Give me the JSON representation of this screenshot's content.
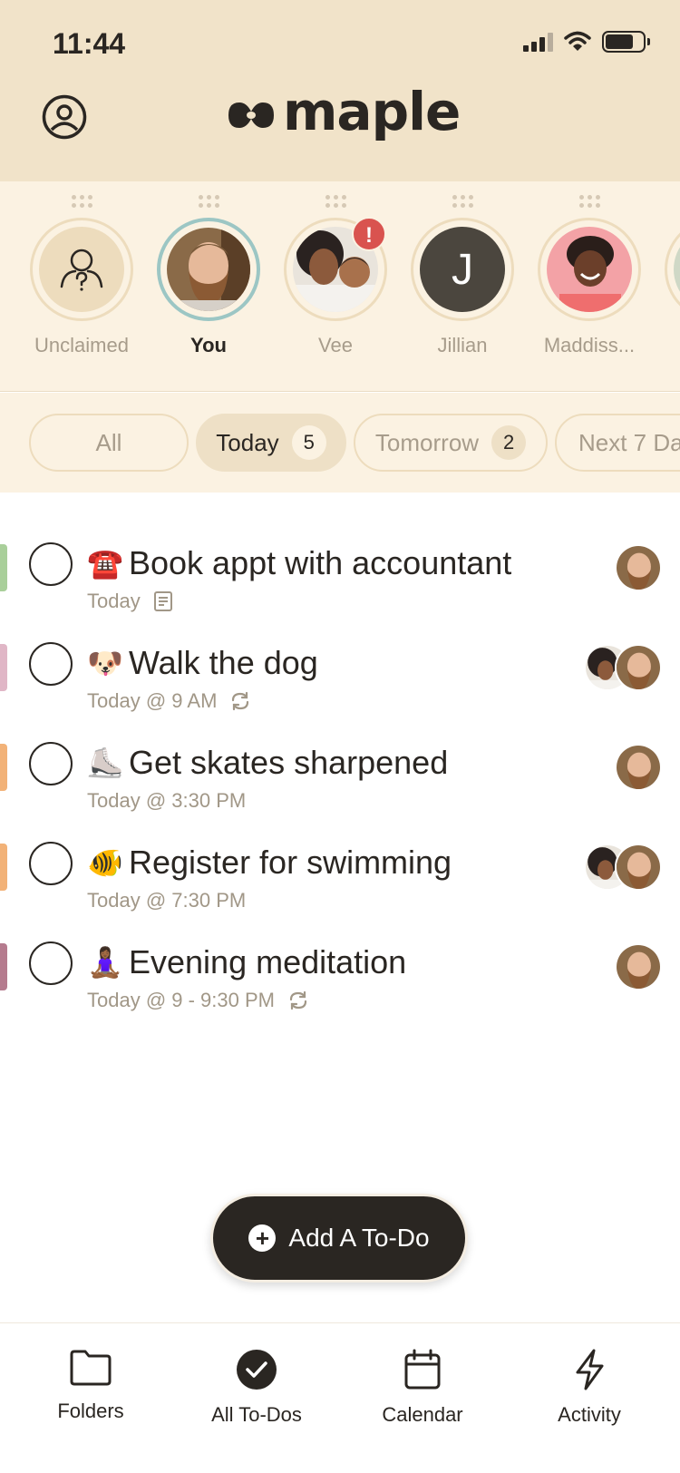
{
  "status_bar": {
    "time": "11:44"
  },
  "header": {
    "logo_text": "maple"
  },
  "people": [
    {
      "name": "Unclaimed",
      "avatar": "unclaimed-icon"
    },
    {
      "name": "You",
      "avatar": "photo-man-beard",
      "selected": true
    },
    {
      "name": "Vee",
      "avatar": "photo-woman-baby",
      "alert": "!"
    },
    {
      "name": "Jillian",
      "avatar": "initial",
      "initial": "J"
    },
    {
      "name": "Maddiss...",
      "avatar": "photo-girl"
    }
  ],
  "filters": [
    {
      "label": "All"
    },
    {
      "label": "Today",
      "count": "5",
      "active": true
    },
    {
      "label": "Tomorrow",
      "count": "2"
    },
    {
      "label": "Next 7 Da"
    }
  ],
  "todos": [
    {
      "emoji": "☎️",
      "title": "Book appt with accountant",
      "meta": "Today",
      "meta_icon": "note-icon",
      "color": "#a9cf9a",
      "assignees": [
        "man"
      ]
    },
    {
      "emoji": "🐶",
      "title": "Walk the dog",
      "meta": "Today @ 9 AM",
      "meta_icon": "repeat-icon",
      "color": "#e0b6c6",
      "assignees": [
        "woman",
        "man"
      ]
    },
    {
      "emoji": "⛸️",
      "title": "Get skates sharpened",
      "meta": "Today @ 3:30 PM",
      "meta_icon": "",
      "color": "#f2b278",
      "assignees": [
        "man"
      ]
    },
    {
      "emoji": "🐠",
      "title": "Register for swimming",
      "meta": "Today @ 7:30 PM",
      "meta_icon": "",
      "color": "#f2b278",
      "assignees": [
        "woman",
        "man"
      ]
    },
    {
      "emoji": "🧘🏾‍♀️",
      "title": "Evening meditation",
      "meta": "Today @ 9 - 9:30 PM",
      "meta_icon": "repeat-icon",
      "color": "#b57b8e",
      "assignees": [
        "man"
      ]
    }
  ],
  "add_button": {
    "label": "Add A To-Do"
  },
  "tabs": [
    {
      "label": "Folders",
      "icon": "folder-icon"
    },
    {
      "label": "All To-Dos",
      "icon": "check-circle-icon"
    },
    {
      "label": "Calendar",
      "icon": "calendar-icon"
    },
    {
      "label": "Activity",
      "icon": "bolt-icon"
    }
  ],
  "colors": {
    "header_bg": "#f1e3c9",
    "panel_bg": "#fbf2e2",
    "ink": "#2a2622",
    "alert": "#d9534f",
    "selected_ring": "#9cc6c4"
  }
}
